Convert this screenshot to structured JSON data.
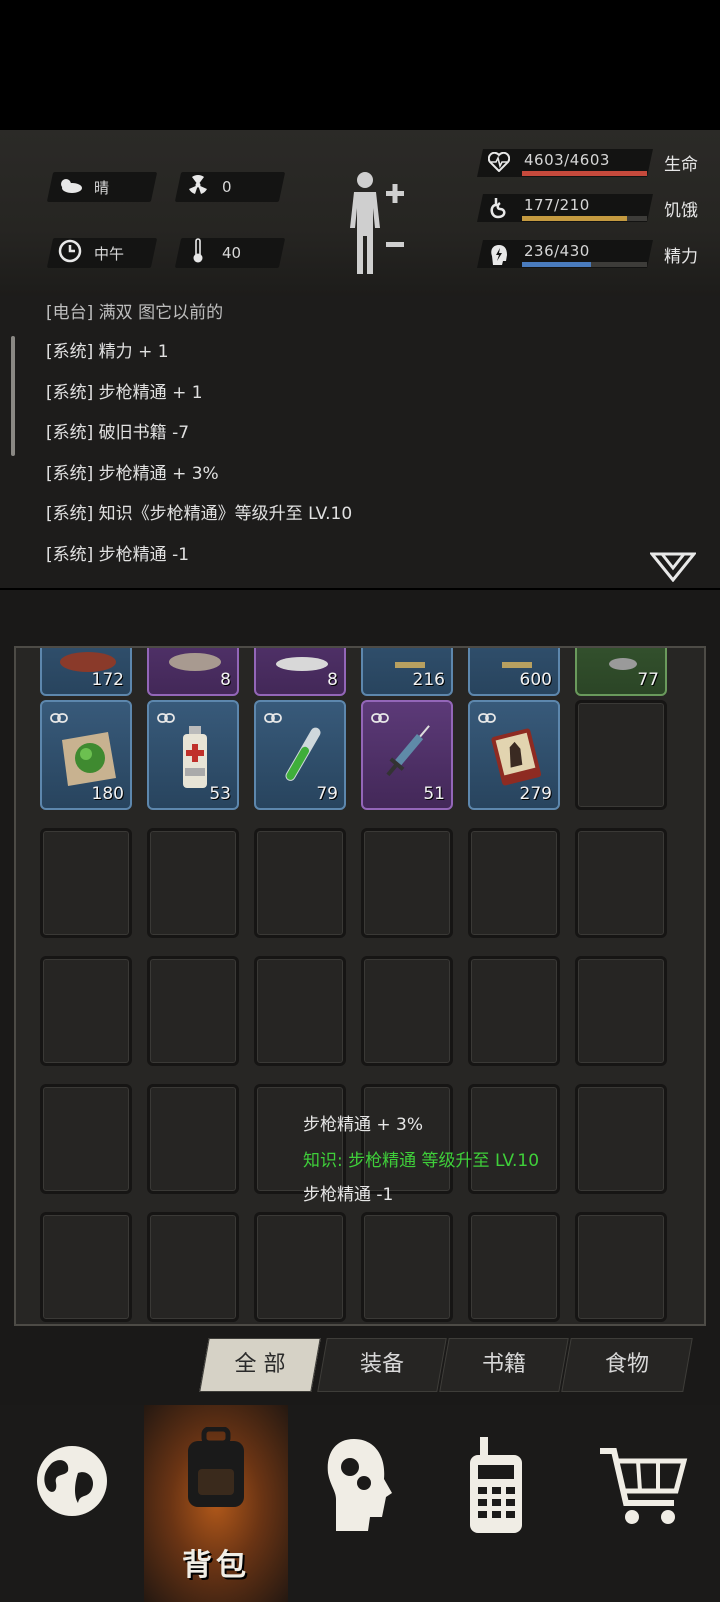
{
  "hud": {
    "weather": "晴",
    "radiation": "0",
    "time_of_day": "中午",
    "temperature": "40",
    "stats": [
      {
        "value": "4603/4603",
        "label": "生命",
        "fraction": 1.0,
        "color": "#c64a3c"
      },
      {
        "value": "177/210",
        "label": "饥饿",
        "fraction": 0.843,
        "color": "#c49a40"
      },
      {
        "value": "236/430",
        "label": "精力",
        "fraction": 0.549,
        "color": "#4a7cbe"
      }
    ]
  },
  "log": {
    "lines": [
      "[电台] 满双 图它以前的",
      "[系统] 精力 + 1",
      "[系统] 步枪精通 + 1",
      "[系统] 破旧书籍 -7",
      "[系统] 步枪精通 + 3%",
      "[系统] 知识《步枪精通》等级升至 LV.10",
      "[系统] 步枪精通 -1"
    ]
  },
  "inventory": {
    "row1_counts": [
      "172",
      "8",
      "8",
      "216",
      "600",
      "77"
    ],
    "row2": [
      {
        "count": "180",
        "rarity": "blue",
        "icon": "green-moss-cloth-icon"
      },
      {
        "count": "53",
        "rarity": "blue",
        "icon": "first-aid-spray-icon"
      },
      {
        "count": "79",
        "rarity": "blue",
        "icon": "test-tube-icon"
      },
      {
        "count": "51",
        "rarity": "purple",
        "icon": "syringe-icon"
      },
      {
        "count": "279",
        "rarity": "blue",
        "icon": "red-book-icon"
      }
    ]
  },
  "float_messages": [
    {
      "text": "步枪精通 + 3%",
      "color": "#e6e6e6"
    },
    {
      "text": "知识: 步枪精通 等级升至 LV.10",
      "color": "#3fcf3a"
    },
    {
      "text": "步枪精通 -1",
      "color": "#e6e6e6"
    }
  ],
  "tabs": [
    "全 部",
    "装备",
    "书籍",
    "食物"
  ],
  "nav": {
    "backpack_label": "背包",
    "items": [
      "globe-icon",
      "backpack-icon",
      "brain-skills-icon",
      "walkie-talkie-icon",
      "shopping-cart-icon"
    ]
  }
}
